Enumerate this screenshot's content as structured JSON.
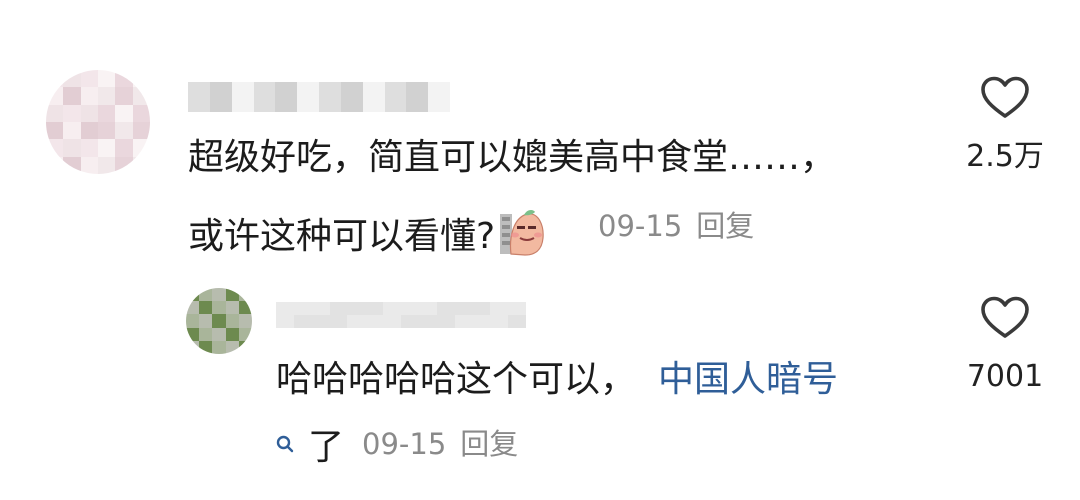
{
  "comment": {
    "text_line1": "超级好吃，简直可以媲美高中食堂……，",
    "text_line2": "或许这种可以看懂?",
    "date": "09-15",
    "reply_label": "回复",
    "like_count": "2.5万"
  },
  "reply": {
    "text": "哈哈哈哈哈这个可以，",
    "link_text": "中国人暗号",
    "trailing_text": "了",
    "date": "09-15",
    "reply_label": "回复",
    "like_count": "7001"
  },
  "icons": {
    "like": "heart-outline-icon",
    "sticker": "emoji-sticker-icon",
    "search": "search-icon"
  },
  "colors": {
    "link": "#2f5e98",
    "meta": "#8a8a8a",
    "heart_stroke": "#3a3a3a"
  }
}
